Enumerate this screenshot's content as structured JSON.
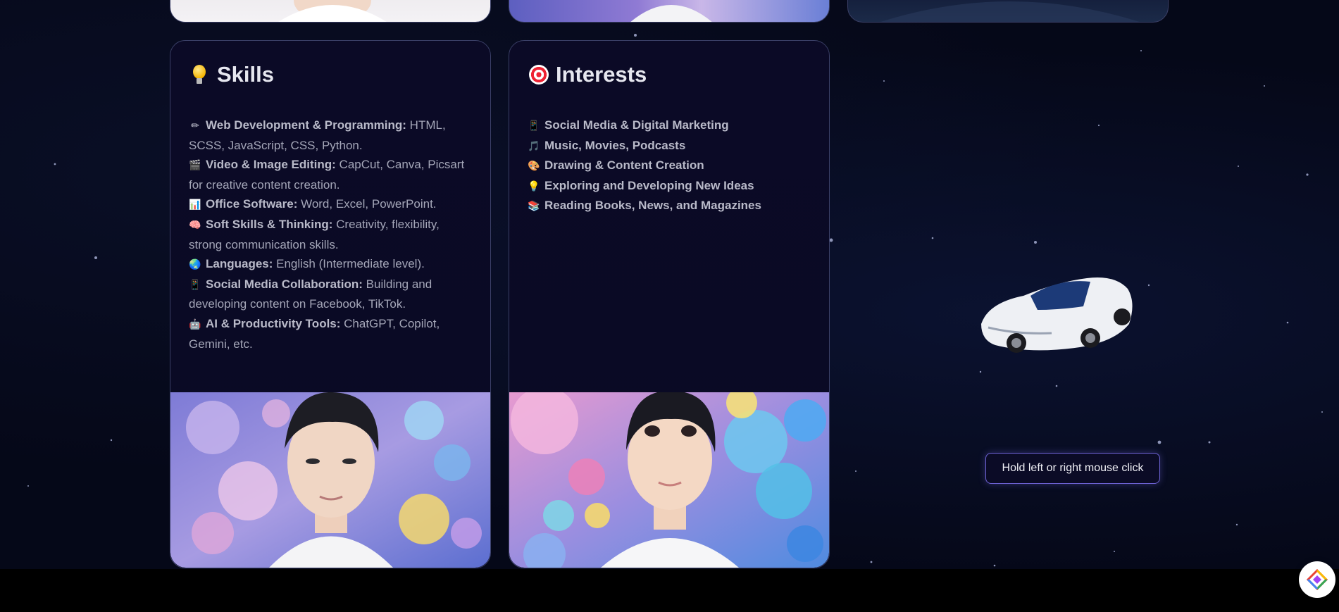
{
  "skills": {
    "title": "Skills",
    "items": [
      {
        "icon": "✏",
        "label": "Web Development & Programming:",
        "text": " HTML, SCSS, JavaScript, CSS, Python."
      },
      {
        "icon": "🎬",
        "label": "Video & Image Editing:",
        "text": " CapCut, Canva, Picsart for creative content creation."
      },
      {
        "icon": "📊",
        "label": "Office Software:",
        "text": " Word, Excel, PowerPoint."
      },
      {
        "icon": "🧠",
        "label": "Soft Skills & Thinking:",
        "text": " Creativity, flexibility, strong communication skills."
      },
      {
        "icon": "🌏",
        "label": "Languages:",
        "text": " English (Intermediate level)."
      },
      {
        "icon": "📱",
        "label": "Social Media Collaboration:",
        "text": " Building and developing content on Facebook, TikTok."
      },
      {
        "icon": "🤖",
        "label": "AI & Productivity Tools:",
        "text": " ChatGPT, Copilot, Gemini, etc."
      }
    ]
  },
  "interests": {
    "title": "Interests",
    "items": [
      {
        "icon": "📱",
        "label": "Social Media & Digital Marketing"
      },
      {
        "icon": "🎵",
        "label": "Music, Movies, Podcasts"
      },
      {
        "icon": "🎨",
        "label": "Drawing & Content Creation"
      },
      {
        "icon": "💡",
        "label": "Exploring and Developing New Ideas"
      },
      {
        "icon": "📚",
        "label": "Reading Books, News, and Magazines"
      }
    ]
  },
  "tooltip": {
    "text": "Hold left or right mouse click"
  },
  "colors": {
    "card_border": "#3a3f66",
    "tooltip_border": "#6e63d6",
    "background": "#050818"
  }
}
